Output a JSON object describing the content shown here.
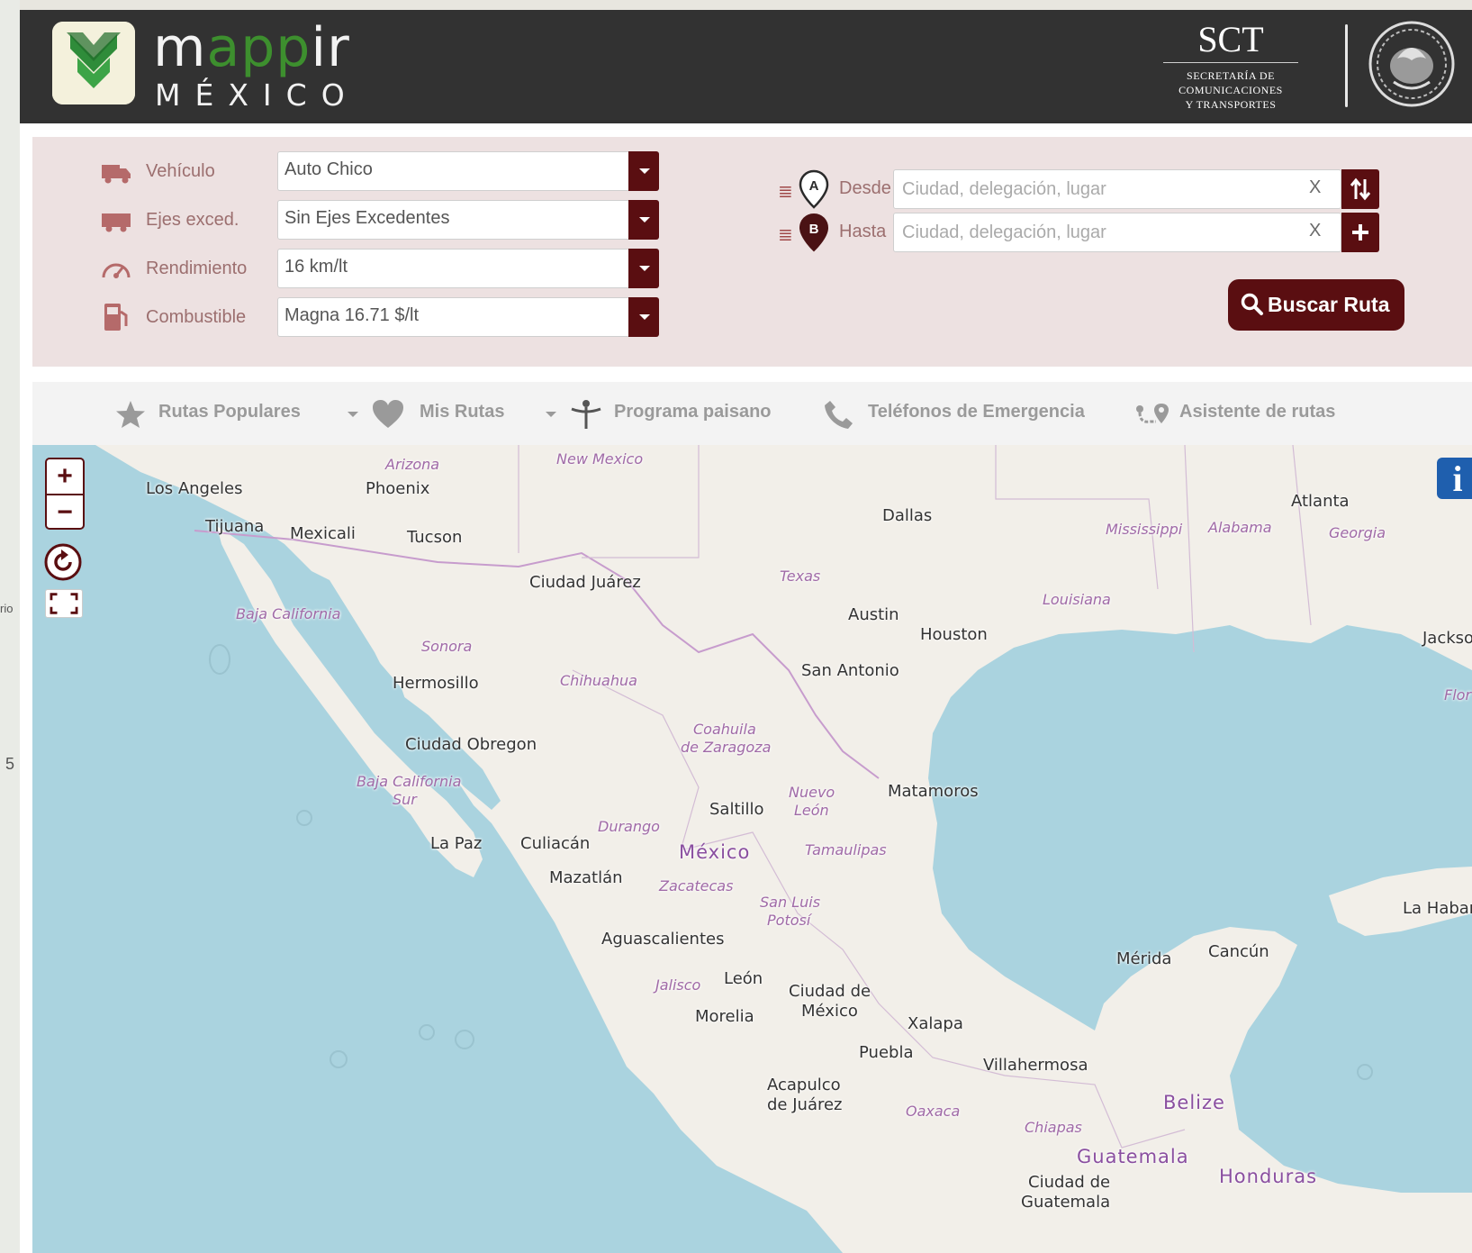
{
  "background_page": {
    "fragments": [
      "rio",
      "5"
    ]
  },
  "header": {
    "logo_word_part1": "m",
    "logo_word_green": "app",
    "logo_word_part2": "ir",
    "logo_country": "MÉXICO",
    "sct_abbr": "SCT",
    "sct_name_line1": "SECRETARÍA DE",
    "sct_name_line2": "COMUNICACIONES",
    "sct_name_line3": "Y TRANSPORTES"
  },
  "vehicle_form": {
    "rows": [
      {
        "label": "Vehículo",
        "value": "Auto Chico",
        "icon": "truck-icon"
      },
      {
        "label": "Ejes exced.",
        "value": "Sin Ejes Excedentes",
        "icon": "trailer-icon"
      },
      {
        "label": "Rendimiento",
        "value": "16 km/lt",
        "icon": "speedometer-icon"
      },
      {
        "label": "Combustible",
        "value": "Magna 16.71 $/lt",
        "icon": "fuel-pump-icon"
      }
    ]
  },
  "route_form": {
    "from": {
      "marker": "A",
      "label": "Desde",
      "placeholder": "Ciudad, delegación, lugar",
      "value": ""
    },
    "to": {
      "marker": "B",
      "label": "Hasta",
      "placeholder": "Ciudad, delegación, lugar",
      "value": ""
    },
    "clear_label": "X",
    "search_button": "Buscar Ruta"
  },
  "nav": {
    "items": [
      {
        "label": "Rutas Populares",
        "icon": "star-icon",
        "dropdown": true
      },
      {
        "label": "Mis Rutas",
        "icon": "heart-icon",
        "dropdown": true
      },
      {
        "label": "Programa paisano",
        "icon": "person-icon",
        "dropdown": false
      },
      {
        "label": "Teléfonos de Emergencia",
        "icon": "phone-icon",
        "dropdown": false
      },
      {
        "label": "Asistente de rutas",
        "icon": "route-assistant-icon",
        "dropdown": false
      }
    ]
  },
  "map": {
    "zoom_in": "+",
    "zoom_out": "−",
    "info": "i",
    "cities": [
      "Los Angeles",
      "Phoenix",
      "Tijuana",
      "Mexicali",
      "Tucson",
      "Dallas",
      "Atlanta",
      "Ciudad Juárez",
      "Austin",
      "Houston",
      "San Antonio",
      "Hermosillo",
      "Ciudad Obregon",
      "Matamoros",
      "Saltillo",
      "La Paz",
      "Culiacán",
      "Mazatlán",
      "Aguascalientes",
      "León",
      "Ciudad de",
      "México",
      "Morelia",
      "Xalapa",
      "Puebla",
      "Mérida",
      "Cancún",
      "Villahermosa",
      "Acapulco",
      "de Juárez",
      "La Habar",
      "Jackso",
      "Ciudad de",
      "Guatemala"
    ],
    "states": [
      "Arizona",
      "New Mexico",
      "Texas",
      "Mississippi",
      "Alabama",
      "Georgia",
      "Louisiana",
      "Baja California",
      "Sonora",
      "Chihuahua",
      "Coahuila",
      "de Zaragoza",
      "Baja California",
      "Sur",
      "Nuevo",
      "León",
      "Durango",
      "Tamaulipas",
      "Zacatecas",
      "San Luis",
      "Potosí",
      "Jalisco",
      "Oaxaca",
      "Chiapas",
      "Flor"
    ],
    "countries": [
      "México",
      "Belize",
      "Guatemala",
      "Honduras"
    ]
  }
}
